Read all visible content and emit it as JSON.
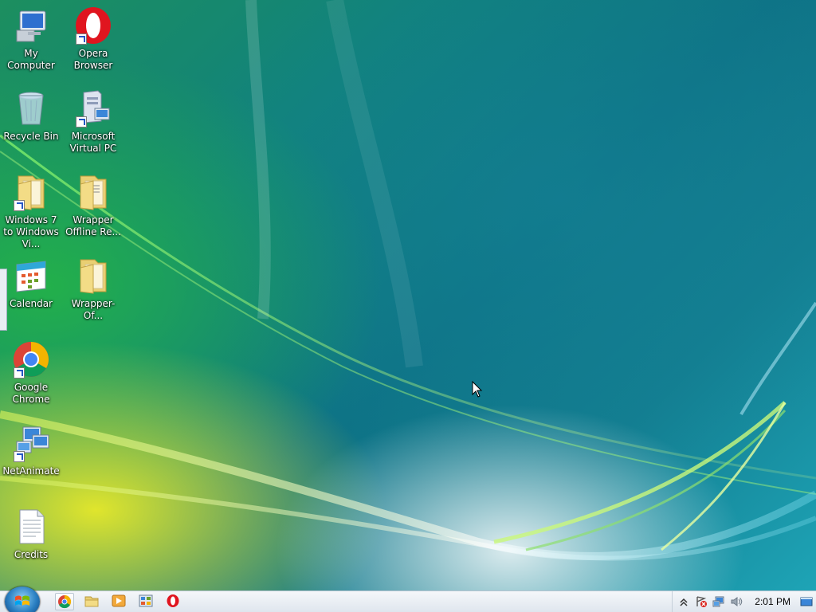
{
  "desktop": {
    "icons": [
      {
        "label": "My Computer",
        "icon": "computer-icon"
      },
      {
        "label": "Opera Browser",
        "icon": "opera-icon"
      },
      {
        "label": "Recycle Bin",
        "icon": "recycle-bin-icon"
      },
      {
        "label": "Microsoft Virtual PC",
        "icon": "virtual-pc-icon"
      },
      {
        "label": "Windows 7 to Windows Vi...",
        "icon": "folder-icon"
      },
      {
        "label": "Wrapper Offline Re...",
        "icon": "folder-documents-icon"
      },
      {
        "label": "Calendar",
        "icon": "calendar-icon"
      },
      {
        "label": "Wrapper-Of...",
        "icon": "folder-icon"
      },
      {
        "label": "Google Chrome",
        "icon": "chrome-icon"
      },
      {
        "label": "NetAnimate",
        "icon": "network-icon"
      },
      {
        "label": "Credits",
        "icon": "text-document-icon"
      }
    ]
  },
  "taskbar": {
    "pinned": [
      "chrome-icon",
      "explorer-icon",
      "media-player-icon",
      "control-panel-icon",
      "opera-icon"
    ],
    "tray": {
      "icons": [
        "show-hidden-icons",
        "action-center-icon",
        "network-icon",
        "volume-icon",
        "show-desktop-icon"
      ],
      "clock": "2:01 PM"
    }
  },
  "colors": {
    "accent": "#2a7fc2",
    "wallpaper_green": "#1c8f5f",
    "wallpaper_teal": "#0e7386"
  }
}
